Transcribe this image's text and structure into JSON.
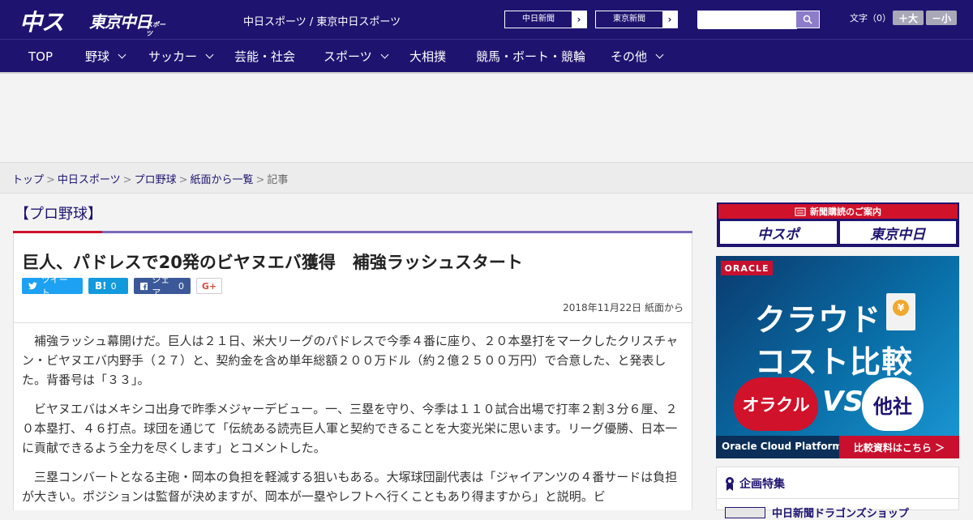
{
  "header": {
    "logo_main": "中スポ",
    "logo_tokyo": "東京中日",
    "logo_tokyo_small": "スポーツ",
    "site_links": "中日スポーツ / 東京中日スポーツ",
    "chunichi_btn": "中日新聞",
    "tokyo_btn": "東京新聞",
    "search_placeholder": "",
    "font_size_label": "文字（0）",
    "font_plus": "＋大",
    "font_minus": "－小"
  },
  "nav": {
    "items": [
      {
        "label": "TOP"
      },
      {
        "label": "野球"
      },
      {
        "label": "サッカー"
      },
      {
        "label": "芸能・社会"
      },
      {
        "label": "スポーツ"
      },
      {
        "label": "大相撲"
      },
      {
        "label": "競馬・ボート・競輪"
      },
      {
        "label": "その他"
      }
    ]
  },
  "breadcrumb": {
    "items": [
      "トップ",
      "中日スポーツ",
      "プロ野球",
      "紙面から一覧"
    ],
    "current": "記事",
    "separator": ">"
  },
  "article": {
    "category": "【プロ野球】",
    "headline": "巨人、パドレスで20発のビヤヌエバ獲得　補強ラッシュスタート",
    "share": {
      "tweet": "ツイート",
      "hatena_icon": "B!",
      "hatena_count": "0",
      "fb_label": "シェア",
      "fb_count": "0",
      "gplus": "G+"
    },
    "dateline": "2018年11月22日 紙面から",
    "paragraphs": [
      "補強ラッシュ幕開けだ。巨人は２１日、米大リーグのパドレスで今季４番に座り、２０本塁打をマークしたクリスチャン・ビヤヌエバ内野手（２７）と、契約金を含め単年総額２００万ドル（約２億２５００万円）で合意した、と発表した。背番号は「３３」。",
      "ビヤヌエバはメキシコ出身で昨季メジャーデビュー。一、三塁を守り、今季は１１０試合出場で打率２割３分６厘、２０本塁打、４６打点。球団を通じて「伝統ある読売巨人軍と契約できることを大変光栄に思います。リーグ優勝、日本一に貢献できるよう全力を尽くします」とコメントした。",
      "三塁コンバートとなる主砲・岡本の負担を軽減する狙いもある。大塚球団副代表は「ジャイアンツの４番サードは負担が大きい。ポジションは監督が決めますが、岡本が一塁やレフトへ行くこともあり得ますから」と説明。ビ"
    ]
  },
  "sidebar": {
    "subscribe_title": "新聞購読のご案内",
    "subscribe_logo1": "中スポ",
    "subscribe_logo2": "東京中日",
    "oracle": {
      "brand": "ORACLE",
      "line1": "クラウド",
      "line2": "コスト比較",
      "coin": "¥",
      "left_cloud": "オラクル",
      "vs": "VS",
      "right_cloud": "他社",
      "footer_left": "Oracle Cloud Platform",
      "footer_right": "比較資料はこちら ＞"
    },
    "feature_title": "企画特集",
    "feature_item": "中日新聞ドラゴンズショップ"
  },
  "colors": {
    "brand_navy": "#1e1470",
    "accent_red": "#d0122a",
    "twitter": "#1da1f2",
    "hatena": "#139adc",
    "facebook": "#3b5998"
  }
}
